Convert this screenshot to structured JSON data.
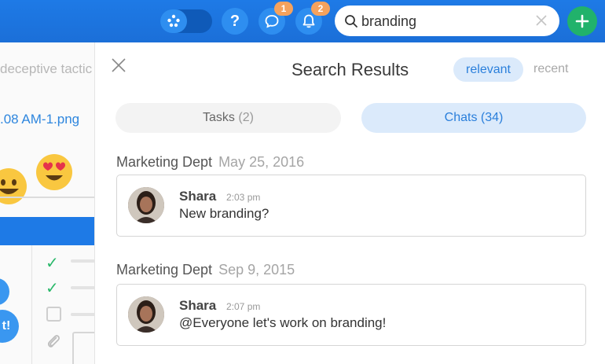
{
  "topbar": {
    "chat_badge": "1",
    "notif_badge": "2",
    "help_label": "?",
    "search": {
      "value": "branding",
      "placeholder": ""
    },
    "colors": {
      "bar": "#1e7ae6",
      "badge": "#f5a25d",
      "add": "#21b26b"
    }
  },
  "background": {
    "text1": "deceptive tactic",
    "text2": ".08 AM-1.png",
    "bubble_text": "t!"
  },
  "panel": {
    "title": "Search Results",
    "sort": {
      "relevant": "relevant",
      "recent": "recent"
    },
    "tabs": [
      {
        "label": "Tasks",
        "count": "(2)"
      },
      {
        "label": "Chats",
        "count": "(34)"
      }
    ],
    "results": [
      {
        "group": "Marketing Dept",
        "date": "May 25, 2016",
        "author": "Shara",
        "time": "2:03 pm",
        "text": "New branding?"
      },
      {
        "group": "Marketing Dept",
        "date": "Sep 9, 2015",
        "author": "Shara",
        "time": "2:07 pm",
        "text": "@Everyone let's work on branding!"
      }
    ]
  }
}
